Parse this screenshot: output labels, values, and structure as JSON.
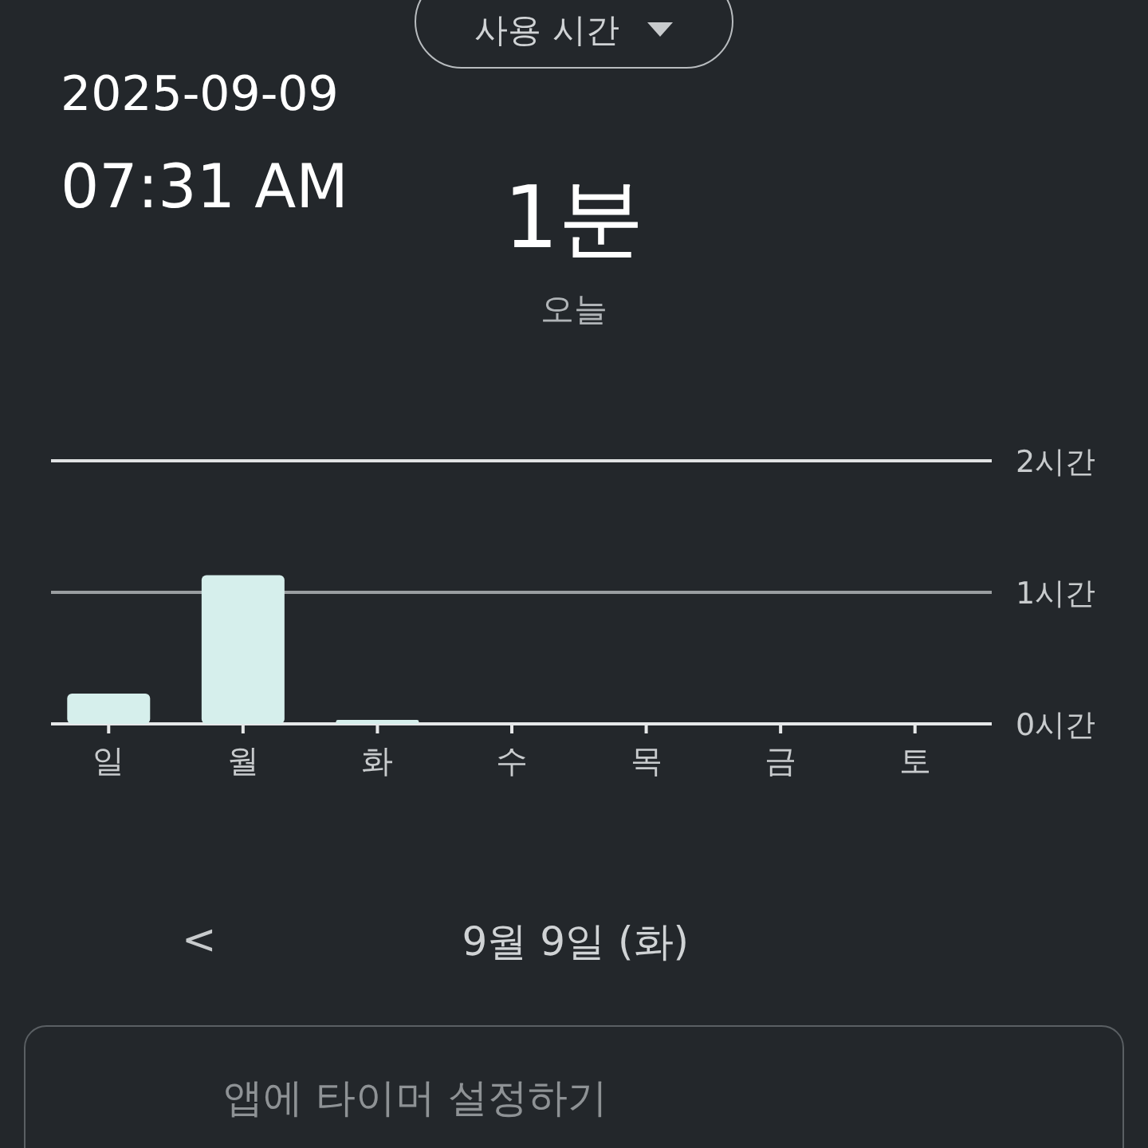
{
  "metric_dropdown": {
    "label": "사용 시간"
  },
  "date": "2025-09-09",
  "time": "07:31 AM",
  "summary": {
    "value": "1분",
    "caption": "오늘"
  },
  "chart_data": {
    "type": "bar",
    "categories": [
      "일",
      "월",
      "화",
      "수",
      "목",
      "금",
      "토"
    ],
    "series": [
      {
        "color": "#d6efec",
        "values": [
          0.23,
          1.13,
          0.03,
          0,
          0,
          0,
          0
        ]
      }
    ],
    "ylim": [
      0,
      2
    ],
    "yticks": [
      {
        "value": 0,
        "label": "0시간"
      },
      {
        "value": 1,
        "label": "1시간"
      },
      {
        "value": 2,
        "label": "2시간"
      }
    ]
  },
  "date_nav": {
    "prev": "<",
    "label": "9월 9일 (화)"
  },
  "timer_card": {
    "label": "앱에 타이머 설정하기"
  }
}
